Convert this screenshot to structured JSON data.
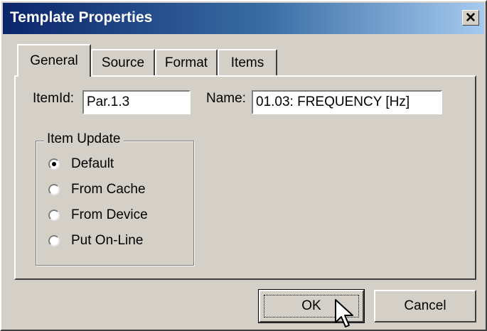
{
  "window": {
    "title": "Template Properties",
    "close_glyph": "✕"
  },
  "tabs": [
    {
      "label": "General",
      "active": true
    },
    {
      "label": "Source",
      "active": false
    },
    {
      "label": "Format",
      "active": false
    },
    {
      "label": "Items",
      "active": false
    }
  ],
  "general": {
    "itemid_label": "ItemId:",
    "itemid_value": "Par.1.3",
    "name_label": "Name:",
    "name_value": "01.03: FREQUENCY [Hz]",
    "item_update": {
      "legend": "Item Update",
      "options": [
        {
          "label": "Default",
          "selected": true
        },
        {
          "label": "From Cache",
          "selected": false
        },
        {
          "label": "From Device",
          "selected": false
        },
        {
          "label": "Put On-Line",
          "selected": false
        }
      ]
    }
  },
  "buttons": {
    "ok": "OK",
    "cancel": "Cancel"
  }
}
